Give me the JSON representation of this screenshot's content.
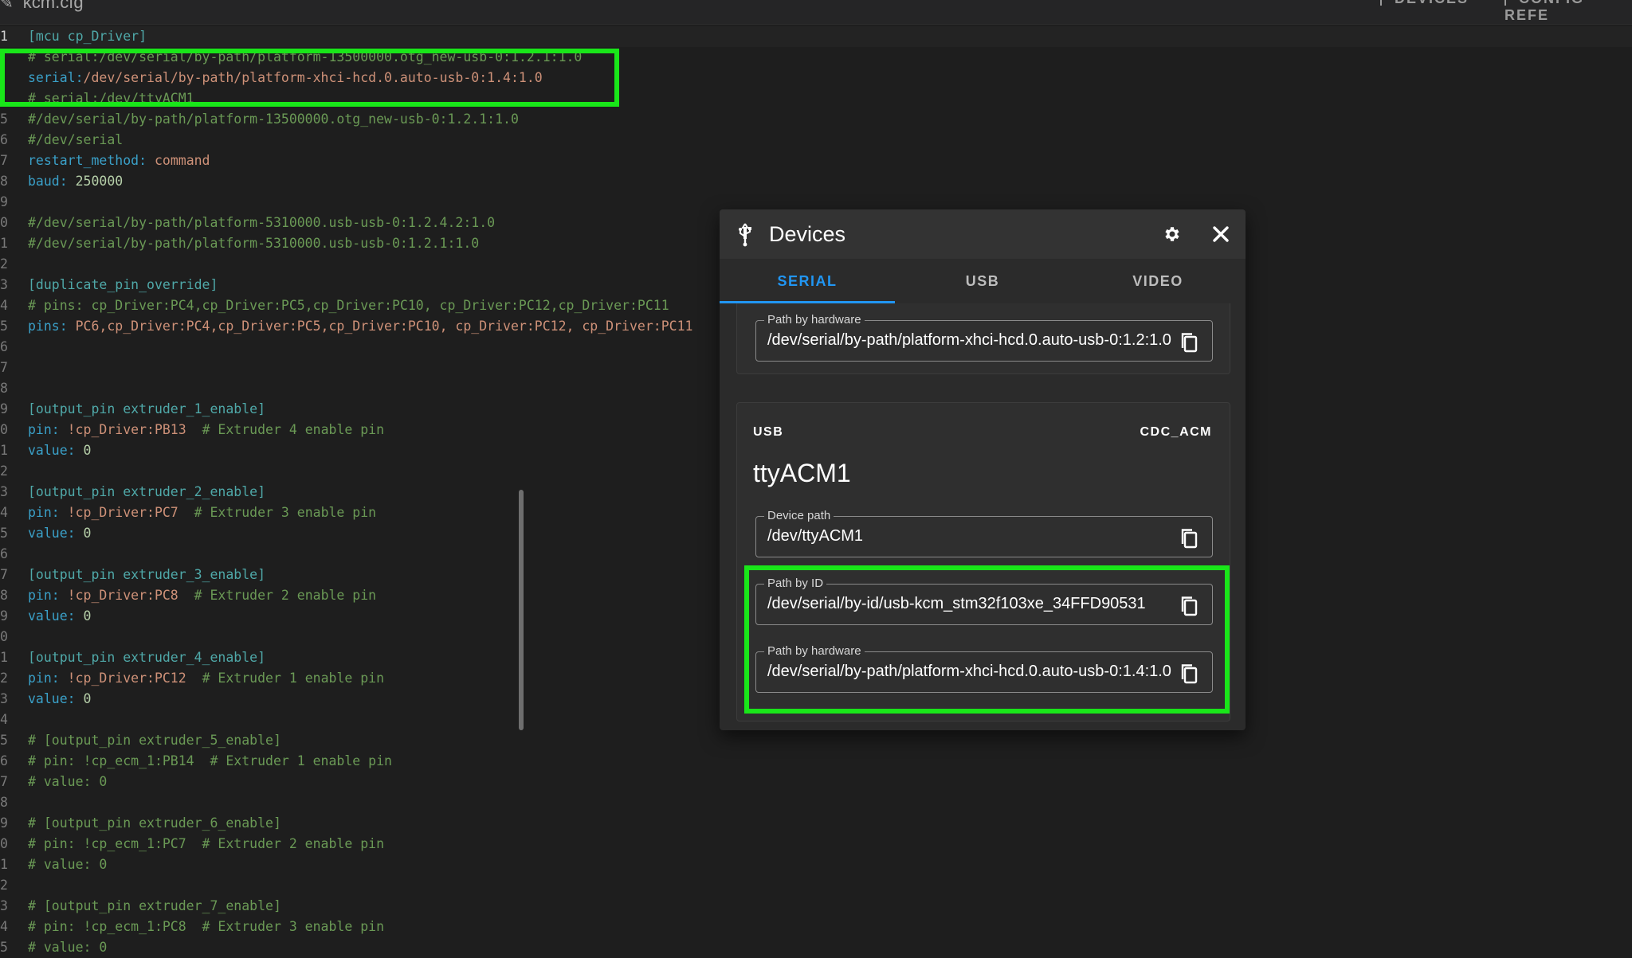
{
  "topbar": {
    "file_name": "kcm.cfg",
    "devices_label": "DEVICES",
    "config_ref_label": "CONFIG REFE"
  },
  "editor": {
    "lines": [
      {
        "n": "1",
        "parts": [
          [
            "section",
            "[mcu cp_Driver]"
          ]
        ]
      },
      {
        "n": "",
        "parts": [
          [
            "comment",
            "# serial:/dev/serial/by-path/platform-13500000.otg_new-usb-0:1.2.1:1.0"
          ]
        ]
      },
      {
        "n": "",
        "parts": [
          [
            "key",
            "serial:"
          ],
          [
            "val",
            "/dev/serial/by-path/platform-xhci-hcd.0.auto-usb-0:1.4:1.0"
          ]
        ]
      },
      {
        "n": "",
        "parts": [
          [
            "comment",
            "# serial:/dev/ttyACM1"
          ]
        ]
      },
      {
        "n": "5",
        "parts": [
          [
            "comment",
            "#/dev/serial/by-path/platform-13500000.otg_new-usb-0:1.2.1:1.0"
          ]
        ]
      },
      {
        "n": "6",
        "parts": [
          [
            "comment",
            "#/dev/serial"
          ]
        ]
      },
      {
        "n": "7",
        "parts": [
          [
            "key",
            "restart_method: "
          ],
          [
            "val",
            "command"
          ]
        ]
      },
      {
        "n": "8",
        "parts": [
          [
            "key",
            "baud: "
          ],
          [
            "num",
            "250000"
          ]
        ]
      },
      {
        "n": "9",
        "parts": []
      },
      {
        "n": "0",
        "parts": [
          [
            "comment",
            "#/dev/serial/by-path/platform-5310000.usb-usb-0:1.2.4.2:1.0"
          ]
        ]
      },
      {
        "n": "1",
        "parts": [
          [
            "comment",
            "#/dev/serial/by-path/platform-5310000.usb-usb-0:1.2.1:1.0"
          ]
        ]
      },
      {
        "n": "2",
        "parts": []
      },
      {
        "n": "3",
        "parts": [
          [
            "section",
            "[duplicate_pin_override]"
          ]
        ]
      },
      {
        "n": "4",
        "parts": [
          [
            "comment",
            "# pins: cp_Driver:PC4,cp_Driver:PC5,cp_Driver:PC10, cp_Driver:PC12,cp_Driver:PC11"
          ]
        ]
      },
      {
        "n": "5",
        "parts": [
          [
            "key",
            "pins: "
          ],
          [
            "val",
            "PC6,cp_Driver:PC4,cp_Driver:PC5,cp_Driver:PC10, cp_Driver:PC12, cp_Driver:PC11"
          ]
        ]
      },
      {
        "n": "6",
        "parts": []
      },
      {
        "n": "7",
        "parts": []
      },
      {
        "n": "8",
        "parts": []
      },
      {
        "n": "9",
        "parts": [
          [
            "section",
            "[output_pin extruder_1_enable]"
          ]
        ]
      },
      {
        "n": "0",
        "parts": [
          [
            "key",
            "pin: "
          ],
          [
            "val",
            "!cp_Driver:PB13  "
          ],
          [
            "comment",
            "# Extruder 4 enable pin"
          ]
        ]
      },
      {
        "n": "1",
        "parts": [
          [
            "key",
            "value: "
          ],
          [
            "num",
            "0"
          ]
        ]
      },
      {
        "n": "2",
        "parts": []
      },
      {
        "n": "3",
        "parts": [
          [
            "section",
            "[output_pin extruder_2_enable]"
          ]
        ]
      },
      {
        "n": "4",
        "parts": [
          [
            "key",
            "pin: "
          ],
          [
            "val",
            "!cp_Driver:PC7  "
          ],
          [
            "comment",
            "# Extruder 3 enable pin"
          ]
        ]
      },
      {
        "n": "5",
        "parts": [
          [
            "key",
            "value: "
          ],
          [
            "num",
            "0"
          ]
        ]
      },
      {
        "n": "6",
        "parts": []
      },
      {
        "n": "7",
        "parts": [
          [
            "section",
            "[output_pin extruder_3_enable]"
          ]
        ]
      },
      {
        "n": "8",
        "parts": [
          [
            "key",
            "pin: "
          ],
          [
            "val",
            "!cp_Driver:PC8  "
          ],
          [
            "comment",
            "# Extruder 2 enable pin"
          ]
        ]
      },
      {
        "n": "9",
        "parts": [
          [
            "key",
            "value: "
          ],
          [
            "num",
            "0"
          ]
        ]
      },
      {
        "n": "0",
        "parts": []
      },
      {
        "n": "1",
        "parts": [
          [
            "section",
            "[output_pin extruder_4_enable]"
          ]
        ]
      },
      {
        "n": "2",
        "parts": [
          [
            "key",
            "pin: "
          ],
          [
            "val",
            "!cp_Driver:PC12  "
          ],
          [
            "comment",
            "# Extruder 1 enable pin"
          ]
        ]
      },
      {
        "n": "3",
        "parts": [
          [
            "key",
            "value: "
          ],
          [
            "num",
            "0"
          ]
        ]
      },
      {
        "n": "4",
        "parts": []
      },
      {
        "n": "5",
        "parts": [
          [
            "comment",
            "# [output_pin extruder_5_enable]"
          ]
        ]
      },
      {
        "n": "6",
        "parts": [
          [
            "comment",
            "# pin: !cp_ecm_1:PB14  # Extruder 1 enable pin"
          ]
        ]
      },
      {
        "n": "7",
        "parts": [
          [
            "comment",
            "# value: 0"
          ]
        ]
      },
      {
        "n": "8",
        "parts": []
      },
      {
        "n": "9",
        "parts": [
          [
            "comment",
            "# [output_pin extruder_6_enable]"
          ]
        ]
      },
      {
        "n": "0",
        "parts": [
          [
            "comment",
            "# pin: !cp_ecm_1:PC7  # Extruder 2 enable pin"
          ]
        ]
      },
      {
        "n": "1",
        "parts": [
          [
            "comment",
            "# value: 0"
          ]
        ]
      },
      {
        "n": "2",
        "parts": []
      },
      {
        "n": "3",
        "parts": [
          [
            "comment",
            "# [output_pin extruder_7_enable]"
          ]
        ]
      },
      {
        "n": "4",
        "parts": [
          [
            "comment",
            "# pin: !cp_ecm_1:PC8  # Extruder 3 enable pin"
          ]
        ]
      },
      {
        "n": "5",
        "parts": [
          [
            "comment",
            "# value: 0"
          ]
        ]
      }
    ]
  },
  "panel": {
    "title": "Devices",
    "tabs": [
      {
        "label": "SERIAL",
        "active": true
      },
      {
        "label": "USB",
        "active": false
      },
      {
        "label": "VIDEO",
        "active": false
      }
    ],
    "top_card": {
      "field_label": "Path by hardware",
      "field_value": "/dev/serial/by-path/platform-xhci-hcd.0.auto-usb-0:1.2:1.0"
    },
    "device_card": {
      "type_label": "USB",
      "driver_label": "CDC_ACM",
      "name": "ttyACM1",
      "fields": [
        {
          "label": "Device path",
          "value": "/dev/ttyACM1"
        },
        {
          "label": "Path by ID",
          "value": "/dev/serial/by-id/usb-kcm_stm32f103xe_34FFD90531"
        },
        {
          "label": "Path by hardware",
          "value": "/dev/serial/by-path/platform-xhci-hcd.0.auto-usb-0:1.4:1.0"
        }
      ]
    }
  },
  "colors": {
    "highlight": "#19e619",
    "accent": "#2196f3"
  }
}
